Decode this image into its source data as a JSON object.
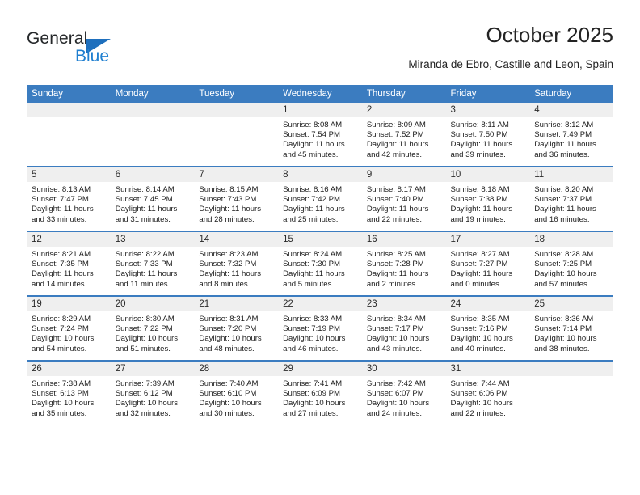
{
  "brand": {
    "name_part1": "General",
    "name_part2": "Blue",
    "accent_color": "#1f7fd0",
    "triangle_color": "#1e6fbd"
  },
  "header": {
    "title": "October 2025",
    "subtitle": "Miranda de Ebro, Castille and Leon, Spain"
  },
  "calendar": {
    "header_color": "#3b7cc0",
    "daynum_band_color": "#efefef",
    "weekdays": [
      "Sunday",
      "Monday",
      "Tuesday",
      "Wednesday",
      "Thursday",
      "Friday",
      "Saturday"
    ],
    "weeks": [
      [
        {
          "day": "",
          "empty": true
        },
        {
          "day": "",
          "empty": true
        },
        {
          "day": "",
          "empty": true
        },
        {
          "day": "1",
          "sunrise": "Sunrise: 8:08 AM",
          "sunset": "Sunset: 7:54 PM",
          "daylight": "Daylight: 11 hours and 45 minutes."
        },
        {
          "day": "2",
          "sunrise": "Sunrise: 8:09 AM",
          "sunset": "Sunset: 7:52 PM",
          "daylight": "Daylight: 11 hours and 42 minutes."
        },
        {
          "day": "3",
          "sunrise": "Sunrise: 8:11 AM",
          "sunset": "Sunset: 7:50 PM",
          "daylight": "Daylight: 11 hours and 39 minutes."
        },
        {
          "day": "4",
          "sunrise": "Sunrise: 8:12 AM",
          "sunset": "Sunset: 7:49 PM",
          "daylight": "Daylight: 11 hours and 36 minutes."
        }
      ],
      [
        {
          "day": "5",
          "sunrise": "Sunrise: 8:13 AM",
          "sunset": "Sunset: 7:47 PM",
          "daylight": "Daylight: 11 hours and 33 minutes."
        },
        {
          "day": "6",
          "sunrise": "Sunrise: 8:14 AM",
          "sunset": "Sunset: 7:45 PM",
          "daylight": "Daylight: 11 hours and 31 minutes."
        },
        {
          "day": "7",
          "sunrise": "Sunrise: 8:15 AM",
          "sunset": "Sunset: 7:43 PM",
          "daylight": "Daylight: 11 hours and 28 minutes."
        },
        {
          "day": "8",
          "sunrise": "Sunrise: 8:16 AM",
          "sunset": "Sunset: 7:42 PM",
          "daylight": "Daylight: 11 hours and 25 minutes."
        },
        {
          "day": "9",
          "sunrise": "Sunrise: 8:17 AM",
          "sunset": "Sunset: 7:40 PM",
          "daylight": "Daylight: 11 hours and 22 minutes."
        },
        {
          "day": "10",
          "sunrise": "Sunrise: 8:18 AM",
          "sunset": "Sunset: 7:38 PM",
          "daylight": "Daylight: 11 hours and 19 minutes."
        },
        {
          "day": "11",
          "sunrise": "Sunrise: 8:20 AM",
          "sunset": "Sunset: 7:37 PM",
          "daylight": "Daylight: 11 hours and 16 minutes."
        }
      ],
      [
        {
          "day": "12",
          "sunrise": "Sunrise: 8:21 AM",
          "sunset": "Sunset: 7:35 PM",
          "daylight": "Daylight: 11 hours and 14 minutes."
        },
        {
          "day": "13",
          "sunrise": "Sunrise: 8:22 AM",
          "sunset": "Sunset: 7:33 PM",
          "daylight": "Daylight: 11 hours and 11 minutes."
        },
        {
          "day": "14",
          "sunrise": "Sunrise: 8:23 AM",
          "sunset": "Sunset: 7:32 PM",
          "daylight": "Daylight: 11 hours and 8 minutes."
        },
        {
          "day": "15",
          "sunrise": "Sunrise: 8:24 AM",
          "sunset": "Sunset: 7:30 PM",
          "daylight": "Daylight: 11 hours and 5 minutes."
        },
        {
          "day": "16",
          "sunrise": "Sunrise: 8:25 AM",
          "sunset": "Sunset: 7:28 PM",
          "daylight": "Daylight: 11 hours and 2 minutes."
        },
        {
          "day": "17",
          "sunrise": "Sunrise: 8:27 AM",
          "sunset": "Sunset: 7:27 PM",
          "daylight": "Daylight: 11 hours and 0 minutes."
        },
        {
          "day": "18",
          "sunrise": "Sunrise: 8:28 AM",
          "sunset": "Sunset: 7:25 PM",
          "daylight": "Daylight: 10 hours and 57 minutes."
        }
      ],
      [
        {
          "day": "19",
          "sunrise": "Sunrise: 8:29 AM",
          "sunset": "Sunset: 7:24 PM",
          "daylight": "Daylight: 10 hours and 54 minutes."
        },
        {
          "day": "20",
          "sunrise": "Sunrise: 8:30 AM",
          "sunset": "Sunset: 7:22 PM",
          "daylight": "Daylight: 10 hours and 51 minutes."
        },
        {
          "day": "21",
          "sunrise": "Sunrise: 8:31 AM",
          "sunset": "Sunset: 7:20 PM",
          "daylight": "Daylight: 10 hours and 48 minutes."
        },
        {
          "day": "22",
          "sunrise": "Sunrise: 8:33 AM",
          "sunset": "Sunset: 7:19 PM",
          "daylight": "Daylight: 10 hours and 46 minutes."
        },
        {
          "day": "23",
          "sunrise": "Sunrise: 8:34 AM",
          "sunset": "Sunset: 7:17 PM",
          "daylight": "Daylight: 10 hours and 43 minutes."
        },
        {
          "day": "24",
          "sunrise": "Sunrise: 8:35 AM",
          "sunset": "Sunset: 7:16 PM",
          "daylight": "Daylight: 10 hours and 40 minutes."
        },
        {
          "day": "25",
          "sunrise": "Sunrise: 8:36 AM",
          "sunset": "Sunset: 7:14 PM",
          "daylight": "Daylight: 10 hours and 38 minutes."
        }
      ],
      [
        {
          "day": "26",
          "sunrise": "Sunrise: 7:38 AM",
          "sunset": "Sunset: 6:13 PM",
          "daylight": "Daylight: 10 hours and 35 minutes."
        },
        {
          "day": "27",
          "sunrise": "Sunrise: 7:39 AM",
          "sunset": "Sunset: 6:12 PM",
          "daylight": "Daylight: 10 hours and 32 minutes."
        },
        {
          "day": "28",
          "sunrise": "Sunrise: 7:40 AM",
          "sunset": "Sunset: 6:10 PM",
          "daylight": "Daylight: 10 hours and 30 minutes."
        },
        {
          "day": "29",
          "sunrise": "Sunrise: 7:41 AM",
          "sunset": "Sunset: 6:09 PM",
          "daylight": "Daylight: 10 hours and 27 minutes."
        },
        {
          "day": "30",
          "sunrise": "Sunrise: 7:42 AM",
          "sunset": "Sunset: 6:07 PM",
          "daylight": "Daylight: 10 hours and 24 minutes."
        },
        {
          "day": "31",
          "sunrise": "Sunrise: 7:44 AM",
          "sunset": "Sunset: 6:06 PM",
          "daylight": "Daylight: 10 hours and 22 minutes."
        },
        {
          "day": "",
          "empty": true
        }
      ]
    ]
  }
}
